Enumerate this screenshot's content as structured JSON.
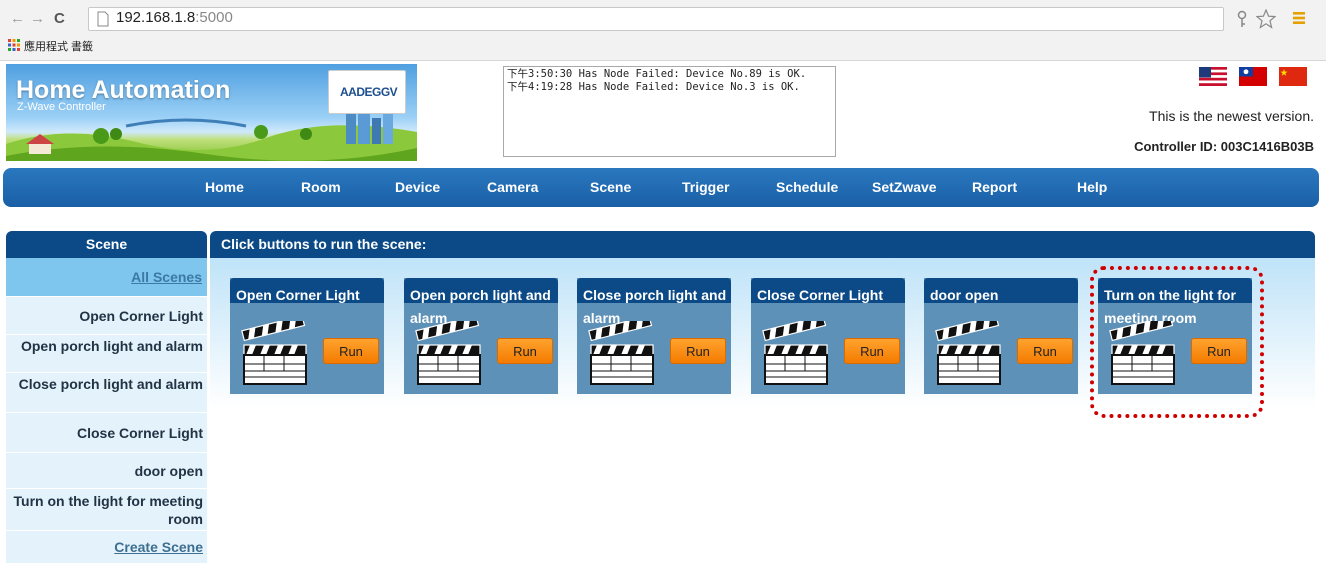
{
  "browser": {
    "back": "←",
    "forward": "→",
    "reload": "C",
    "url_host": "192.168.1.8",
    "url_port": ":5000",
    "bookmarks": "應用程式   書籤"
  },
  "header": {
    "title": "Home Automation",
    "subtitle": "Z-Wave Controller",
    "logo_text": "AADEGGV",
    "log_lines": "下午3:50:30 Has Node Failed: Device No.89 is OK.\n下午4:19:28 Has Node Failed: Device No.3 is OK.",
    "newest": "This is the newest version.",
    "controller_id": "Controller ID: 003C1416B03B"
  },
  "nav": [
    "Home",
    "Room",
    "Device",
    "Camera",
    "Scene",
    "Trigger",
    "Schedule",
    "SetZwave",
    "Report",
    "Help"
  ],
  "sidebar": {
    "header": "Scene",
    "all_scenes": "All Scenes",
    "items": [
      "Open Corner Light",
      "Open porch light and alarm",
      "Close porch light and alarm",
      "Close Corner Light",
      "door open",
      "Turn on the light for meeting room"
    ],
    "create": "Create Scene"
  },
  "main": {
    "header": "Click buttons to run the scene:",
    "run_label": "Run",
    "scenes": [
      "Open Corner Light",
      "Open porch light and alarm",
      "Close porch light and alarm",
      "Close Corner Light",
      "door open",
      "Turn on the light for meeting room"
    ]
  },
  "colors": {
    "nav_blue": "#1a5fa6",
    "header_navy": "#0b4a86",
    "run_orange": "#f47b00",
    "highlight_red": "#d00000"
  }
}
